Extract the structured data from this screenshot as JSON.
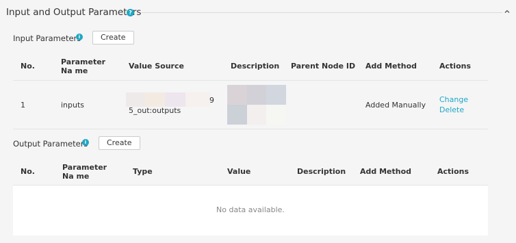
{
  "section": {
    "title": "Input and Output Parameters",
    "help_icon": "?"
  },
  "input_params": {
    "label": "Input Parameters",
    "info_icon": "i",
    "create_label": "Create",
    "columns": [
      "No.",
      "Parameter Na me",
      "Value Source",
      "Description",
      "Parent Node ID",
      "Add Method",
      "Actions"
    ],
    "rows": [
      {
        "no": "1",
        "name": "inputs",
        "value_source_tail": "9",
        "value_source_line2": "5_out:outputs",
        "parent_node_id": "",
        "add_method": "Added Manually",
        "actions": [
          "Change",
          "Delete"
        ]
      }
    ]
  },
  "output_params": {
    "label": "Output Parameters",
    "info_icon": "i",
    "create_label": "Create",
    "columns": [
      "No.",
      "Parameter Na me",
      "Type",
      "Value",
      "Description",
      "Add Method",
      "Actions"
    ],
    "empty_text": "No data available."
  }
}
